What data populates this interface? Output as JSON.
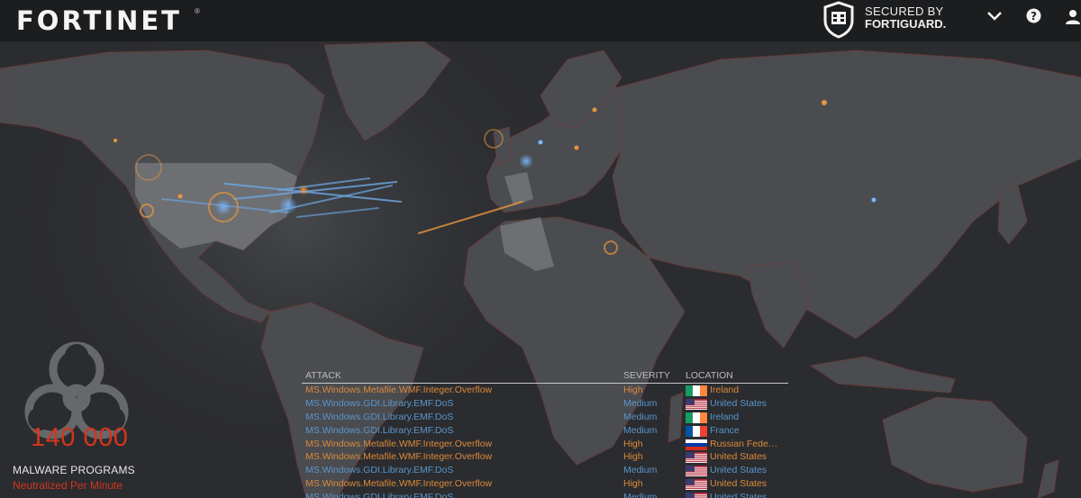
{
  "header": {
    "brand": "FORTINET",
    "brand_mark": "®",
    "secured_line1": "SECURED BY",
    "secured_line2": "FORTIGUARD.",
    "icons": [
      "fortiguard-shield-icon",
      "chevron-down-icon",
      "help-icon",
      "user-icon"
    ]
  },
  "malware": {
    "count": "140 000",
    "label": "MALWARE PROGRAMS",
    "sublabel": "Neutralized Per Minute",
    "icon": "biohazard-icon"
  },
  "attacks": {
    "headers": {
      "attack": "ATTACK",
      "severity": "SEVERITY",
      "location": "LOCATION"
    },
    "rows": [
      {
        "attack": "MS.Windows.Metafile.WMF.Integer.Overflow",
        "severity": "High",
        "location": "Ireland",
        "flag": "ie"
      },
      {
        "attack": "MS.Windows.GDI.Library.EMF.DoS",
        "severity": "Medium",
        "location": "United States",
        "flag": "us"
      },
      {
        "attack": "MS.Windows.GDI.Library.EMF.DoS",
        "severity": "Medium",
        "location": "Ireland",
        "flag": "ie"
      },
      {
        "attack": "MS.Windows.GDI.Library.EMF.DoS",
        "severity": "Medium",
        "location": "France",
        "flag": "fr"
      },
      {
        "attack": "MS.Windows.Metafile.WMF.Integer.Overflow",
        "severity": "High",
        "location": "Russian Fede…",
        "flag": "ru"
      },
      {
        "attack": "MS.Windows.Metafile.WMF.Integer.Overflow",
        "severity": "High",
        "location": "United States",
        "flag": "us"
      },
      {
        "attack": "MS.Windows.GDI.Library.EMF.DoS",
        "severity": "Medium",
        "location": "United States",
        "flag": "us"
      },
      {
        "attack": "MS.Windows.Metafile.WMF.Integer.Overflow",
        "severity": "High",
        "location": "United States",
        "flag": "us"
      },
      {
        "attack": "MS.Windows.GDI.Library.EMF.DoS",
        "severity": "Medium",
        "location": "United States",
        "flag": "us"
      }
    ]
  },
  "colors": {
    "high": "#dd8a3a",
    "medium": "#5a96cc",
    "counter": "#d2361d",
    "land": "#4a4c50",
    "ocean": "#2b2c2f"
  }
}
